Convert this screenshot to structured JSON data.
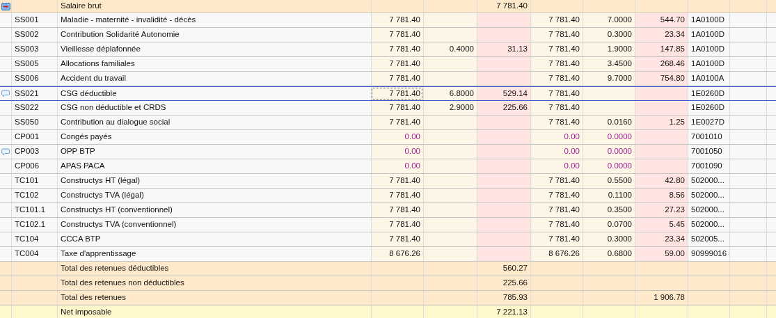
{
  "rows": [
    {
      "kind": "header",
      "expanded": true,
      "label": "Salaire brut",
      "amount": "7 781.40"
    },
    {
      "kind": "line",
      "code": "SS001",
      "label": "Maladie - maternité - invalidité - décès",
      "base": "7 781.40",
      "base2": "7 781.40",
      "rate2": "7.0000",
      "amount2": "544.70",
      "account": "1A0100D",
      "comment": false,
      "selected": false,
      "inactive": false
    },
    {
      "kind": "line",
      "code": "SS002",
      "label": "Contribution Solidarité Autonomie",
      "base": "7 781.40",
      "base2": "7 781.40",
      "rate2": "0.3000",
      "amount2": "23.34",
      "account": "1A0100D",
      "comment": false,
      "selected": false,
      "inactive": false
    },
    {
      "kind": "line",
      "code": "SS003",
      "label": "Vieillesse déplafonnée",
      "base": "7 781.40",
      "rate": "0.4000",
      "amount": "31.13",
      "base2": "7 781.40",
      "rate2": "1.9000",
      "amount2": "147.85",
      "account": "1A0100D",
      "comment": false,
      "selected": false,
      "inactive": false
    },
    {
      "kind": "line",
      "code": "SS005",
      "label": "Allocations familiales",
      "base": "7 781.40",
      "base2": "7 781.40",
      "rate2": "3.4500",
      "amount2": "268.46",
      "account": "1A0100D",
      "comment": false,
      "selected": false,
      "inactive": false
    },
    {
      "kind": "line",
      "code": "SS006",
      "label": "Accident du travail",
      "base": "7 781.40",
      "base2": "7 781.40",
      "rate2": "9.7000",
      "amount2": "754.80",
      "account": "1A0100A",
      "comment": false,
      "selected": false,
      "inactive": false
    },
    {
      "kind": "line",
      "code": "SS021",
      "label": "CSG déductible",
      "base": "7 781.40",
      "rate": "6.8000",
      "amount": "529.14",
      "base2": "7 781.40",
      "account": "1E0260D",
      "comment": true,
      "selected": true,
      "inactive": false
    },
    {
      "kind": "line",
      "code": "SS022",
      "label": "CSG non déductible et CRDS",
      "base": "7 781.40",
      "rate": "2.9000",
      "amount": "225.66",
      "base2": "7 781.40",
      "account": "1E0260D",
      "comment": false,
      "selected": false,
      "inactive": false
    },
    {
      "kind": "line",
      "code": "SS050",
      "label": "Contribution au dialogue social",
      "base": "7 781.40",
      "base2": "7 781.40",
      "rate2": "0.0160",
      "amount2": "1.25",
      "account": "1E0027D",
      "comment": false,
      "selected": false,
      "inactive": false
    },
    {
      "kind": "line",
      "code": "CP001",
      "label": "Congés payés",
      "base": "0.00",
      "base2": "0.00",
      "rate2": "0.0000",
      "account": "7001010",
      "comment": false,
      "selected": false,
      "inactive": true
    },
    {
      "kind": "line",
      "code": "CP003",
      "label": "OPP BTP",
      "base": "0.00",
      "base2": "0.00",
      "rate2": "0.0000",
      "account": "7001050",
      "comment": true,
      "selected": false,
      "inactive": true
    },
    {
      "kind": "line",
      "code": "CP006",
      "label": "APAS PACA",
      "base": "0.00",
      "base2": "0.00",
      "rate2": "0.0000",
      "account": "7001090",
      "comment": false,
      "selected": false,
      "inactive": true
    },
    {
      "kind": "line",
      "code": "TC101",
      "label": "Constructys HT (légal)",
      "base": "7 781.40",
      "base2": "7 781.40",
      "rate2": "0.5500",
      "amount2": "42.80",
      "account": "502000...",
      "comment": false,
      "selected": false,
      "inactive": false
    },
    {
      "kind": "line",
      "code": "TC102",
      "label": "Constructys TVA (légal)",
      "base": "7 781.40",
      "base2": "7 781.40",
      "rate2": "0.1100",
      "amount2": "8.56",
      "account": "502000...",
      "comment": false,
      "selected": false,
      "inactive": false
    },
    {
      "kind": "line",
      "code": "TC101.1",
      "label": "Constructys HT (conventionnel)",
      "base": "7 781.40",
      "base2": "7 781.40",
      "rate2": "0.3500",
      "amount2": "27.23",
      "account": "502000...",
      "comment": false,
      "selected": false,
      "inactive": false
    },
    {
      "kind": "line",
      "code": "TC102.1",
      "label": "Constructys TVA (conventionnel)",
      "base": "7 781.40",
      "base2": "7 781.40",
      "rate2": "0.0700",
      "amount2": "5.45",
      "account": "502000...",
      "comment": false,
      "selected": false,
      "inactive": false
    },
    {
      "kind": "line",
      "code": "TC104",
      "label": "CCCA BTP",
      "base": "7 781.40",
      "base2": "7 781.40",
      "rate2": "0.3000",
      "amount2": "23.34",
      "account": "502005...",
      "comment": false,
      "selected": false,
      "inactive": false
    },
    {
      "kind": "line",
      "code": "TC004",
      "label": "Taxe d'apprentissage",
      "base": "8 676.26",
      "base2": "8 676.26",
      "rate2": "0.6800",
      "amount2": "59.00",
      "account": "90999016",
      "comment": false,
      "selected": false,
      "inactive": false
    },
    {
      "kind": "total",
      "label": "Total des retenues déductibles",
      "amount": "560.27"
    },
    {
      "kind": "total",
      "label": "Total des retenues non déductibles",
      "amount": "225.66"
    },
    {
      "kind": "total",
      "label": "Total des retenues",
      "amount": "785.93",
      "amount2": "1 906.78"
    },
    {
      "kind": "net",
      "label": "Net imposable",
      "amount": "7 221.13"
    }
  ]
}
